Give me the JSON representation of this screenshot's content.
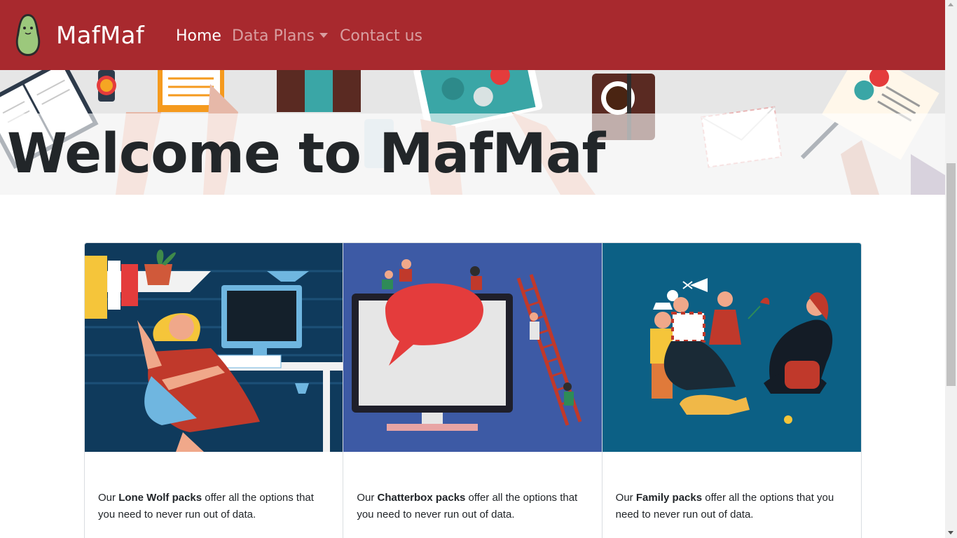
{
  "navbar": {
    "brand": "MafMaf",
    "logo_icon": "avocado-logo-icon",
    "links": {
      "home": "Home",
      "data_plans": "Data Plans",
      "contact": "Contact us"
    },
    "dropdown_icon": "caret-down-icon"
  },
  "hero": {
    "title": "Welcome to MafMaf"
  },
  "cards": [
    {
      "prefix": "Our ",
      "plan": "Lone Wolf packs",
      "suffix": " offer all the options that you need to never run out of data."
    },
    {
      "prefix": "Our ",
      "plan": "Chatterbox packs",
      "suffix": " offer all the options that you need to never run out of data."
    },
    {
      "prefix": "Our ",
      "plan": "Family packs",
      "suffix": " offer all the options that you need to never run out of data."
    }
  ],
  "colors": {
    "navbar_bg": "#a8292e",
    "card1_bg": "#0f3a5c",
    "card2_bg": "#3d5aa5",
    "card3_bg": "#0c6085"
  }
}
